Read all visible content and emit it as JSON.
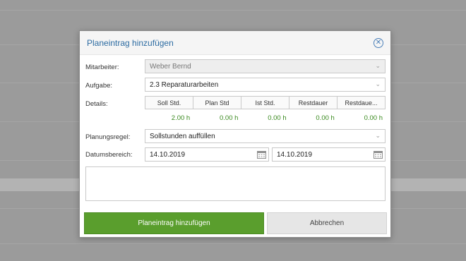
{
  "dialog": {
    "title": "Planeintrag hinzufügen",
    "close_icon": "close-circle-icon"
  },
  "form": {
    "employee_label": "Mitarbeiter:",
    "employee_value": "Weber Bernd",
    "task_label": "Aufgabe:",
    "task_value": "2.3 Reparaturarbeiten",
    "details_label": "Details:",
    "details_columns": [
      "Soll Std.",
      "Plan Std",
      "Ist Std.",
      "Restdauer",
      "Restdaue..."
    ],
    "details_values": [
      "2.00 h",
      "0.00 h",
      "0.00 h",
      "0.00 h",
      "0.00 h"
    ],
    "rule_label": "Planungsregel:",
    "rule_value": "Sollstunden auffüllen",
    "date_label": "Datumsbereich:",
    "date_from": "14.10.2019",
    "date_to": "14.10.2019",
    "notes_value": ""
  },
  "buttons": {
    "add_label": "Planeintrag hinzufügen",
    "cancel_label": "Abbrechen"
  },
  "colors": {
    "title": "#2d6ca2",
    "primary_button": "#5a9e2d",
    "value_green": "#3a8a1f"
  }
}
